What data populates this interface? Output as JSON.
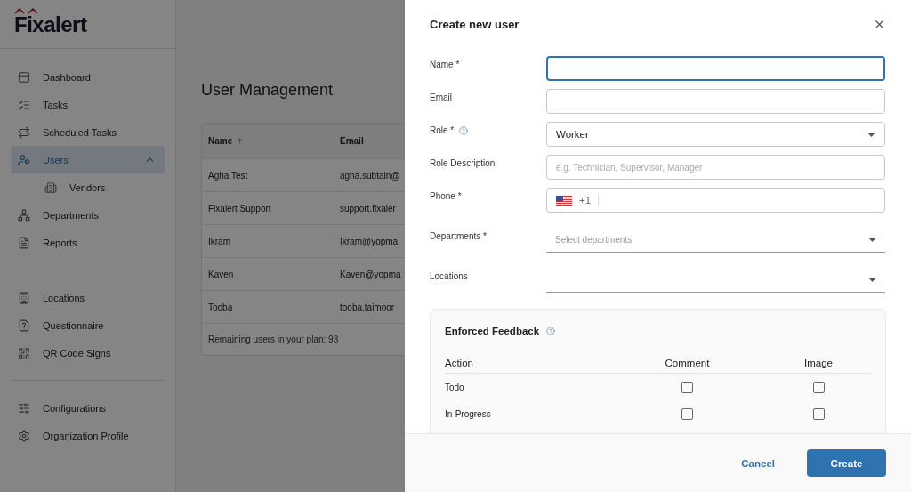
{
  "logo": "Fixalert",
  "nav_sections": [
    [
      {
        "label": "Dashboard",
        "selected": false
      },
      {
        "label": "Tasks",
        "selected": false
      },
      {
        "label": "Scheduled Tasks",
        "selected": false
      },
      {
        "label": "Users",
        "selected": true,
        "expanded": true,
        "children": [
          {
            "label": "Vendors",
            "selected": false
          }
        ]
      },
      {
        "label": "Departments",
        "selected": false
      },
      {
        "label": "Reports",
        "selected": false
      }
    ],
    [
      {
        "label": "Locations",
        "selected": false
      },
      {
        "label": "Questionnaire",
        "selected": false
      },
      {
        "label": "QR Code Signs",
        "selected": false
      }
    ],
    [
      {
        "label": "Configurations",
        "selected": false
      },
      {
        "label": "Organization Profile",
        "selected": false
      }
    ]
  ],
  "page": {
    "title": "User Management",
    "columns": [
      {
        "label": "Name",
        "sorted": true
      },
      {
        "label": "Email"
      }
    ],
    "rows": [
      {
        "name": "Agha Test",
        "email": "agha.subtain@"
      },
      {
        "name": "Fixalert Support",
        "email": "support.fixaler"
      },
      {
        "name": "Ikram",
        "email": "Ikram@yopma"
      },
      {
        "name": "Kaven",
        "email": "Kaven@yopma"
      },
      {
        "name": "Tooba",
        "email": "tooba.taimoor"
      }
    ],
    "footer": "Remaining users in your plan: 93"
  },
  "drawer": {
    "title": "Create new user",
    "fields": [
      {
        "label": "Name *",
        "kind": "text",
        "focused": true
      },
      {
        "label": "Email",
        "kind": "text"
      },
      {
        "label": "Role *",
        "kind": "select",
        "value": "Worker",
        "help": true
      },
      {
        "label": "Role Description",
        "kind": "text",
        "placeholder": "e.g. Technician, Supervisor, Manager"
      },
      {
        "label": "Phone *",
        "kind": "phone",
        "prefix": "+1"
      },
      {
        "label": "Departments *",
        "kind": "multiselect",
        "placeholder": "Select departments"
      },
      {
        "label": "Locations",
        "kind": "multiselect"
      }
    ],
    "feedback": {
      "title": "Enforced Feedback",
      "columns": [
        "Action",
        "Comment",
        "Image"
      ],
      "rows": [
        {
          "action": "Todo",
          "comment": false,
          "image": false
        },
        {
          "action": "In-Progress",
          "comment": false,
          "image": false
        }
      ]
    },
    "cancel": "Cancel",
    "create": "Create"
  }
}
